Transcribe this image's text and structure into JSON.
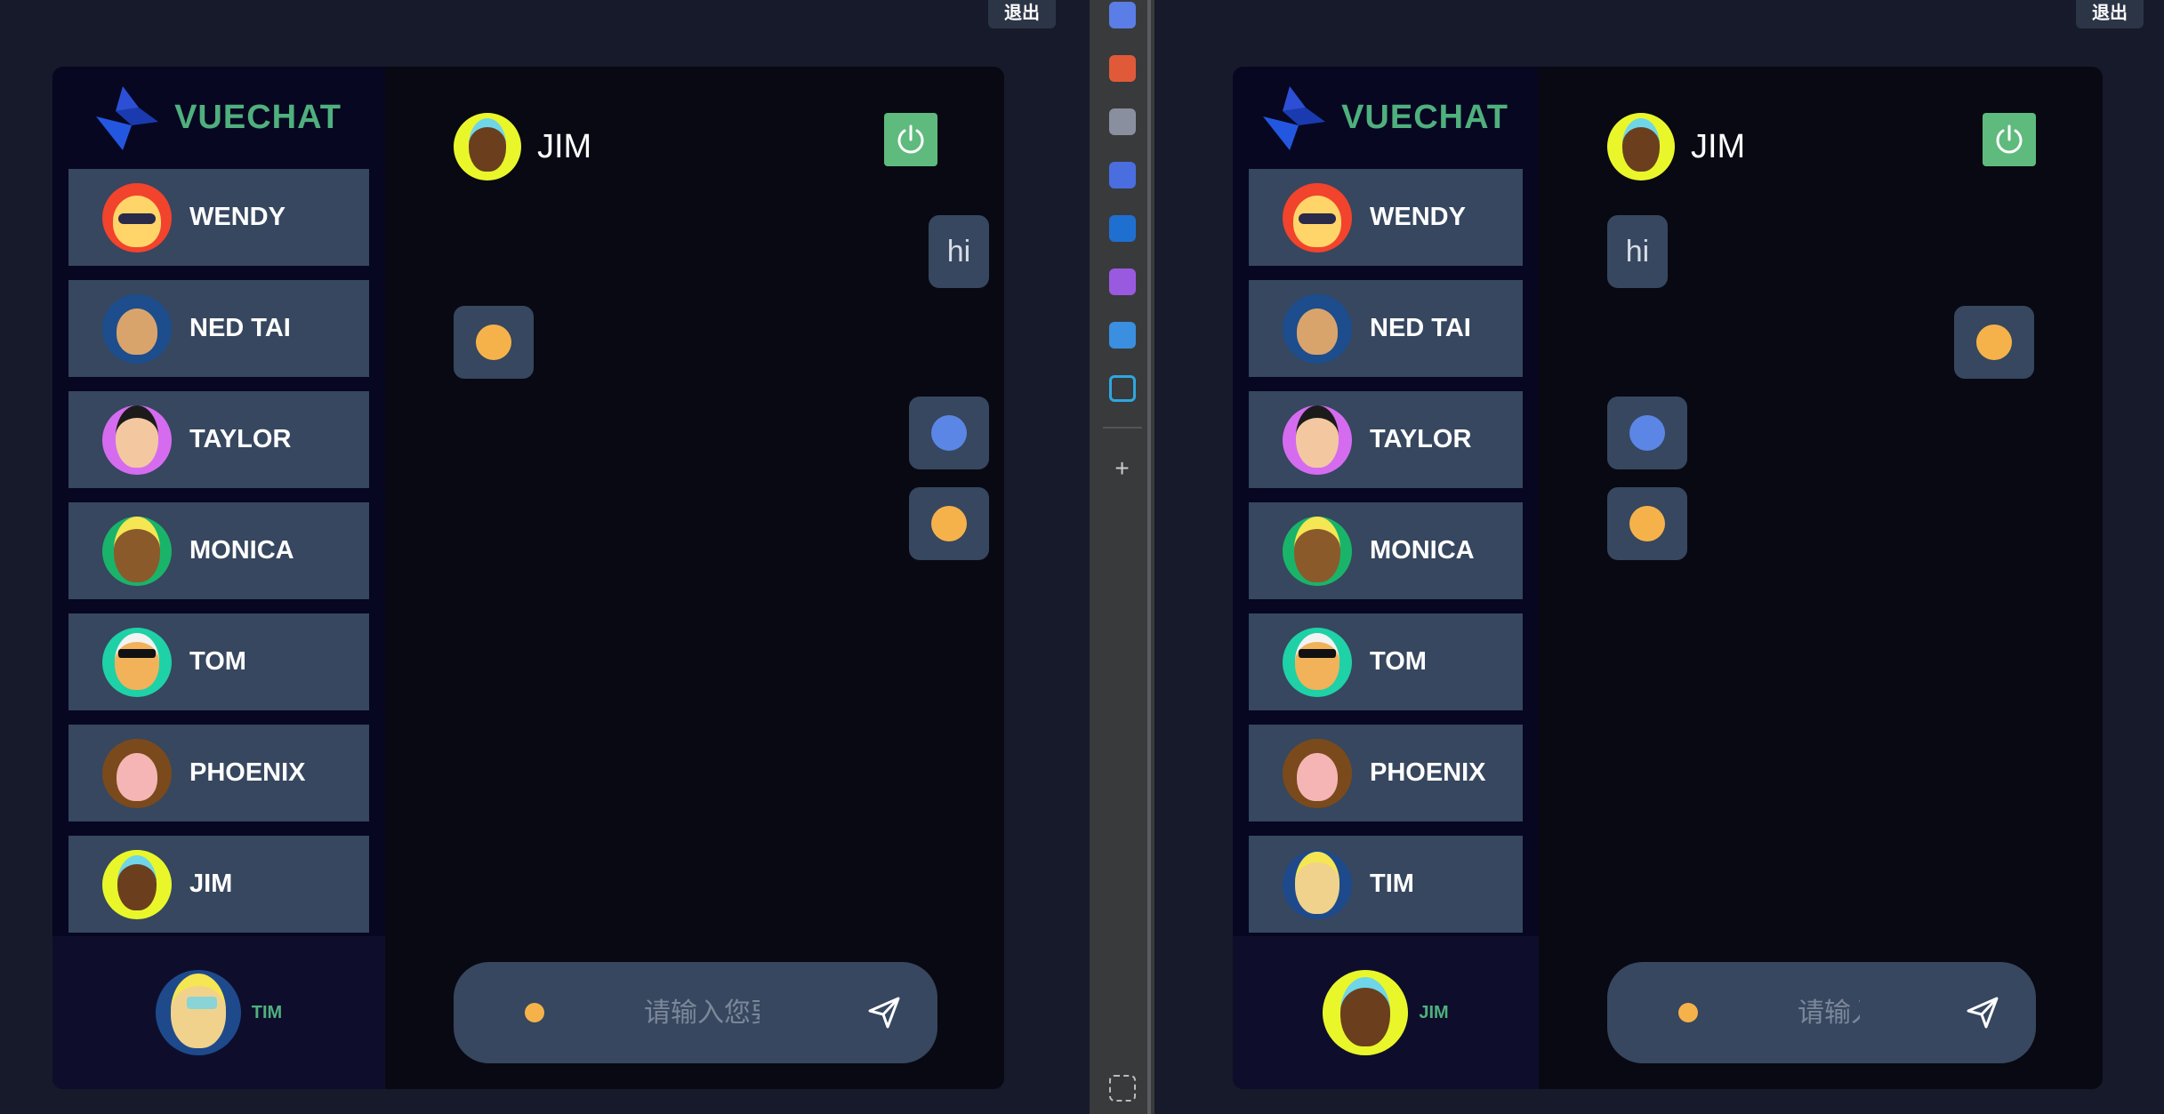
{
  "left_window": {
    "logout_label": "退出",
    "brand": "VUECHAT",
    "contacts": [
      {
        "name": "WENDY",
        "avatar": "wendy-avatar",
        "bg": "#f2432c",
        "face": "#ffd56a"
      },
      {
        "name": "NED TAI",
        "avatar": "ned-tai-avatar",
        "bg": "#1d4d8c",
        "face": "#d9a46c"
      },
      {
        "name": "TAYLOR",
        "avatar": "taylor-avatar",
        "bg": "#d56cf0",
        "face": "#f3c8a0"
      },
      {
        "name": "MONICA",
        "avatar": "monica-avatar",
        "bg": "#19b46a",
        "face": "#8b5a2b"
      },
      {
        "name": "TOM",
        "avatar": "tom-avatar",
        "bg": "#1fd1a6",
        "face": "#f1b25a"
      },
      {
        "name": "PHOENIX",
        "avatar": "phoenix-avatar",
        "bg": "#7a4a1c",
        "face": "#f6b5b5"
      },
      {
        "name": "JIM",
        "avatar": "jim-avatar",
        "bg": "#e9f72a",
        "face": "#6b3f1d"
      }
    ],
    "me": {
      "name": "TIM",
      "avatar": "tim-avatar"
    },
    "chat_with": "JIM",
    "input_placeholder": "请输入您要",
    "messages": [
      {
        "side": "right",
        "type": "text",
        "content": "hi"
      },
      {
        "side": "left",
        "type": "emoji",
        "content": "flushed-face-emoji"
      },
      {
        "side": "right",
        "type": "emoji",
        "content": "cold-face-emoji"
      },
      {
        "side": "right",
        "type": "emoji",
        "content": "relieved-face-emoji"
      }
    ]
  },
  "right_window": {
    "logout_label": "退出",
    "brand": "VUECHAT",
    "contacts": [
      {
        "name": "WENDY",
        "avatar": "wendy-avatar"
      },
      {
        "name": "NED TAI",
        "avatar": "ned-tai-avatar"
      },
      {
        "name": "TAYLOR",
        "avatar": "taylor-avatar"
      },
      {
        "name": "MONICA",
        "avatar": "monica-avatar"
      },
      {
        "name": "TOM",
        "avatar": "tom-avatar"
      },
      {
        "name": "PHOENIX",
        "avatar": "phoenix-avatar"
      },
      {
        "name": "TIM",
        "avatar": "tim-avatar"
      }
    ],
    "me": {
      "name": "JIM",
      "avatar": "jim-avatar"
    },
    "chat_with": "JIM",
    "input_placeholder": "请输入",
    "messages": [
      {
        "side": "left",
        "type": "text",
        "content": "hi"
      },
      {
        "side": "right",
        "type": "emoji",
        "content": "flushed-face-emoji"
      },
      {
        "side": "left",
        "type": "emoji",
        "content": "cold-face-emoji"
      },
      {
        "side": "left",
        "type": "emoji",
        "content": "relieved-face-emoji"
      }
    ]
  },
  "edge_sidebar": {
    "icons": [
      "tag-icon",
      "briefcase-icon",
      "chess-icon",
      "copilot-icon",
      "outlook-icon",
      "pen-icon",
      "send-icon",
      "bilibili-icon"
    ],
    "add_icon": "plus-icon",
    "bottom_icon": "screenshot-icon"
  },
  "colors": {
    "background": "#161a2a",
    "app_bg": "#090913",
    "sidebar_bg": "#070722",
    "contact_bg": "#36475f",
    "accent": "#4fb07d",
    "power_button": "#5fba7d"
  }
}
